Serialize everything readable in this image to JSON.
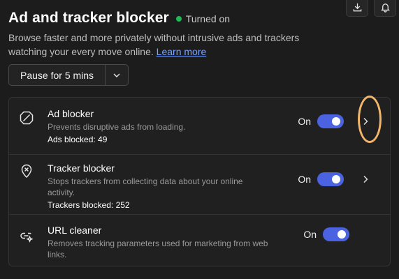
{
  "header": {
    "title": "Ad and tracker blocker",
    "status": "Turned on",
    "status_color": "#1db954",
    "description": "Browse faster and more privately without intrusive ads and trackers watching your every move online.",
    "learn_more": "Learn more"
  },
  "top_actions": [
    {
      "icon": "download-icon"
    },
    {
      "icon": "bell-icon"
    }
  ],
  "pause": {
    "label": "Pause for 5 mins",
    "dropdown_icon": "chevron-down-icon"
  },
  "features": [
    {
      "icon": "ad-block-icon",
      "title": "Ad blocker",
      "subtitle": "Prevents disruptive ads from loading.",
      "stat": "Ads blocked: 49",
      "toggle_label": "On",
      "enabled": true
    },
    {
      "icon": "location-x-icon",
      "title": "Tracker blocker",
      "subtitle": "Stops trackers from collecting data about your online activity.",
      "stat": "Trackers blocked: 252",
      "toggle_label": "On",
      "enabled": true
    },
    {
      "icon": "link-clean-icon",
      "title": "URL cleaner",
      "subtitle": "Removes tracking parameters used for marketing from web links.",
      "toggle_label": "On",
      "enabled": true
    }
  ],
  "colors": {
    "background": "#1c1c1c",
    "panel": "#202020",
    "accent": "#4b63e0",
    "link": "#7aa2ff",
    "highlight": "#f2b66b"
  }
}
